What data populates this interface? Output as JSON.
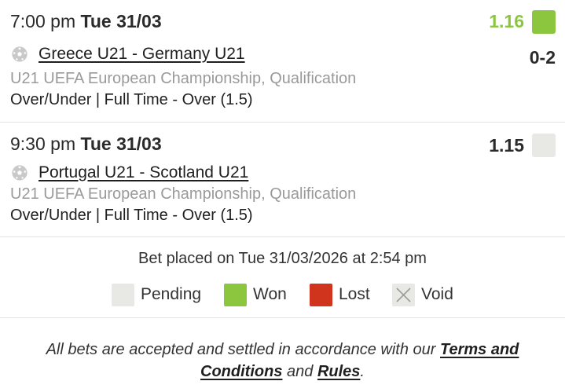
{
  "bets": [
    {
      "time": "7:00 pm",
      "date": "Tue 31/03",
      "odds": "1.16",
      "status": "won",
      "match": "Greece U21 - Germany U21",
      "score": "0-2",
      "competition": "U21 UEFA European Championship, Qualification",
      "market": "Over/Under | Full Time - Over (1.5)"
    },
    {
      "time": "9:30 pm",
      "date": "Tue 31/03",
      "odds": "1.15",
      "status": "pending",
      "match": "Portugal U21 - Scotland U21",
      "score": "",
      "competition": "U21 UEFA European Championship, Qualification",
      "market": "Over/Under | Full Time - Over (1.5)"
    }
  ],
  "placed_text": "Bet placed on Tue 31/03/2026 at 2:54 pm",
  "legend": {
    "pending": "Pending",
    "won": "Won",
    "lost": "Lost",
    "void": "Void"
  },
  "colors": {
    "won": "#8cc63f",
    "pending": "#e8e8e4",
    "lost": "#d0341c",
    "void": "#e8e8e4"
  },
  "icons": {
    "sport": "football-icon",
    "void": "x-icon"
  },
  "footer": {
    "text_before": "All bets are accepted and settled in accordance with our ",
    "terms_link": "Terms and Conditions",
    "text_middle": " and ",
    "rules_link": "Rules",
    "text_after": "."
  }
}
